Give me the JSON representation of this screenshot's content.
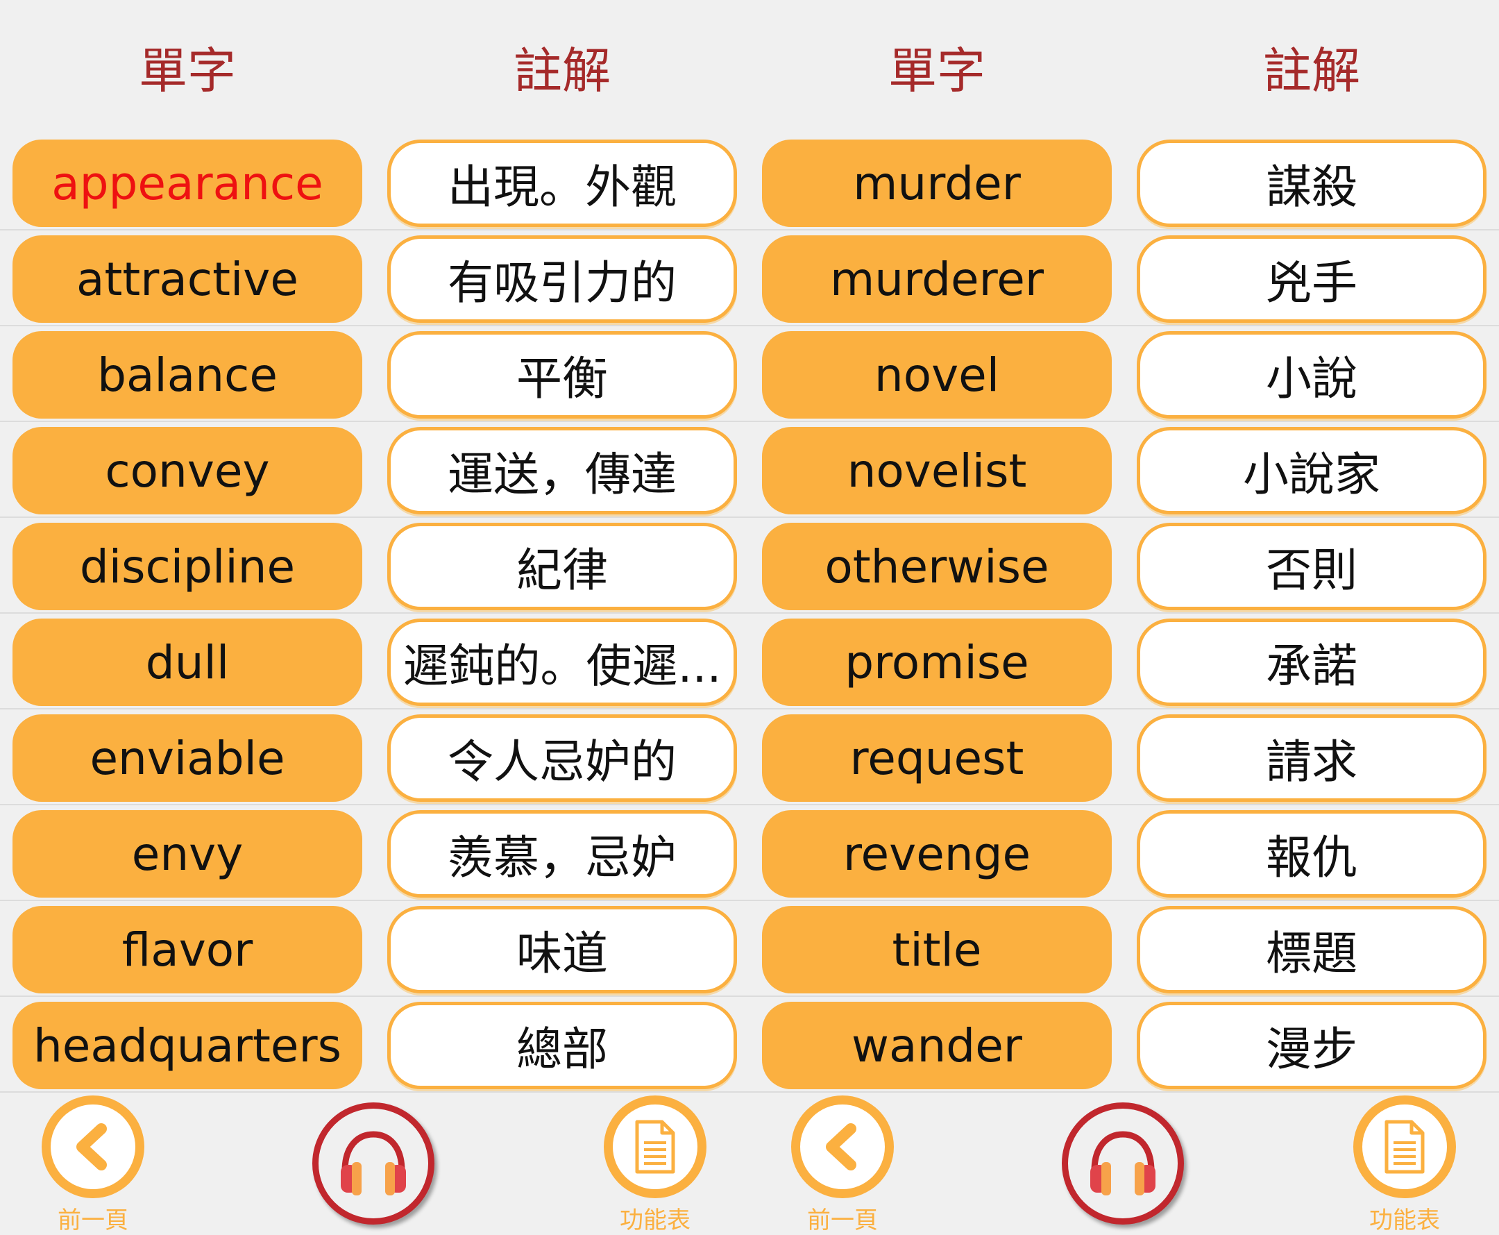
{
  "colors": {
    "accent": "#fbb040",
    "header": "#a52a2a",
    "active_word": "#ee1111",
    "audio_ring": "#c1272d"
  },
  "panels": [
    {
      "header": {
        "word": "單字",
        "note": "註解"
      },
      "rows": [
        {
          "word": "appearance",
          "note": "出現。外觀",
          "active": true
        },
        {
          "word": "attractive",
          "note": "有吸引力的"
        },
        {
          "word": "balance",
          "note": "平衡"
        },
        {
          "word": "convey",
          "note": "運送，傳達"
        },
        {
          "word": "discipline",
          "note": "紀律"
        },
        {
          "word": "dull",
          "note": "遲鈍的。使遲..."
        },
        {
          "word": "enviable",
          "note": "令人忌妒的"
        },
        {
          "word": "envy",
          "note": "羨慕，忌妒"
        },
        {
          "word": "flavor",
          "note": "味道"
        },
        {
          "word": "headquarters",
          "note": "總部"
        }
      ],
      "toolbar": {
        "prev_label": "前一頁",
        "menu_label": "功能表",
        "prev_icon": "chevron-left-icon",
        "audio_icon": "headphones-icon",
        "menu_icon": "document-icon"
      }
    },
    {
      "header": {
        "word": "單字",
        "note": "註解"
      },
      "rows": [
        {
          "word": "murder",
          "note": "謀殺"
        },
        {
          "word": "murderer",
          "note": "兇手"
        },
        {
          "word": "novel",
          "note": "小說"
        },
        {
          "word": "novelist",
          "note": "小說家"
        },
        {
          "word": "otherwise",
          "note": "否則"
        },
        {
          "word": "promise",
          "note": "承諾"
        },
        {
          "word": "request",
          "note": "請求"
        },
        {
          "word": "revenge",
          "note": "報仇"
        },
        {
          "word": "title",
          "note": "標題"
        },
        {
          "word": "wander",
          "note": "漫步"
        }
      ],
      "toolbar": {
        "prev_label": "前一頁",
        "menu_label": "功能表",
        "prev_icon": "chevron-left-icon",
        "audio_icon": "headphones-icon",
        "menu_icon": "document-icon"
      }
    }
  ]
}
